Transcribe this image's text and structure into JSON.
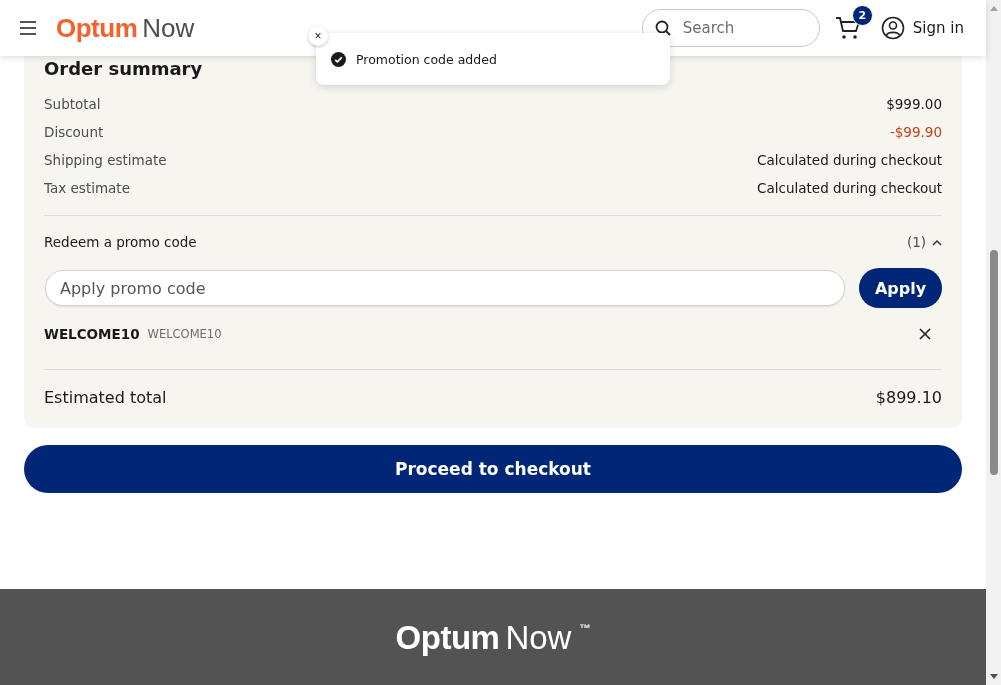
{
  "header": {
    "logo": {
      "brand": "Optum",
      "product": "Now"
    },
    "search": {
      "placeholder": "Search"
    },
    "cart": {
      "count": "2"
    },
    "sign_in": "Sign in"
  },
  "toast": {
    "message": "Promotion code added",
    "close": "×"
  },
  "order_summary": {
    "title": "Order summary",
    "lines": [
      {
        "label": "Subtotal",
        "value": "$999.00",
        "kind": "plain"
      },
      {
        "label": "Discount",
        "value": "-$99.90",
        "kind": "discount"
      },
      {
        "label": "Shipping estimate",
        "value": "Calculated during checkout",
        "kind": "plain"
      },
      {
        "label": "Tax estimate",
        "value": "Calculated during checkout",
        "kind": "plain"
      }
    ],
    "promo": {
      "title": "Redeem a promo code",
      "count": "(1)",
      "expanded": true,
      "placeholder": "Apply promo code",
      "apply": "Apply",
      "codes": [
        {
          "code": "WELCOME10",
          "description": "WELCOME10"
        }
      ]
    },
    "total": {
      "label": "Estimated total",
      "value": "$899.10"
    }
  },
  "checkout": "Proceed to checkout",
  "footer": {
    "logo": {
      "brand": "Optum",
      "product": "Now",
      "mark": "™"
    }
  }
}
